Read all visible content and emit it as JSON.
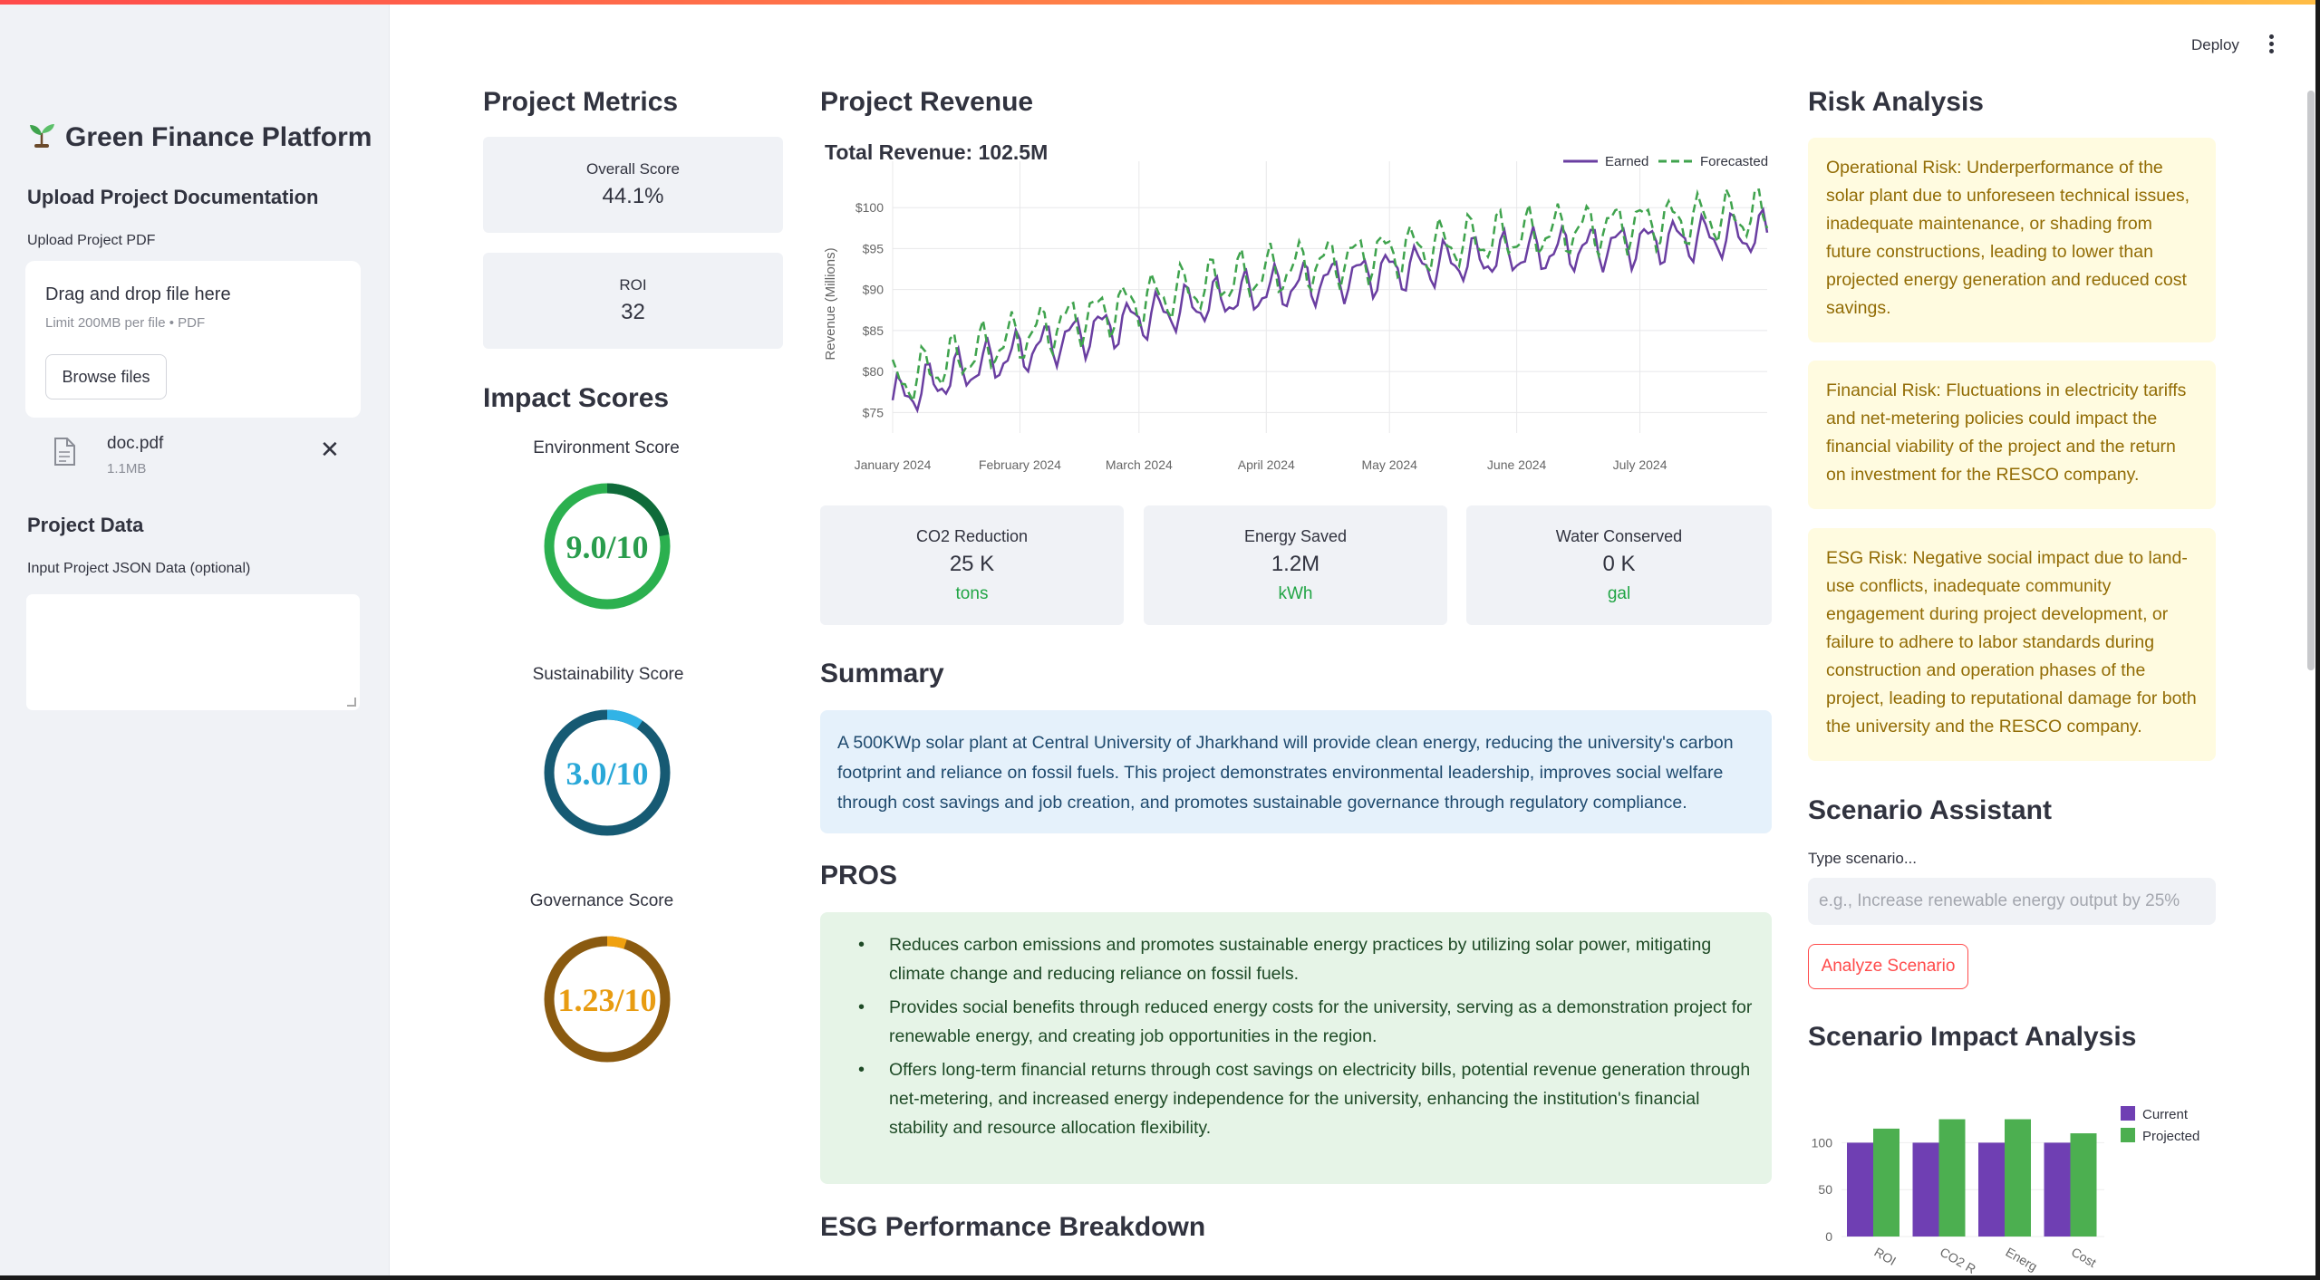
{
  "sidebar": {
    "title": "Green Finance Platform",
    "upload_heading": "Upload Project Documentation",
    "upload_label": "Upload Project PDF",
    "dropzone_text": "Drag and drop file here",
    "dropzone_limit": "Limit 200MB per file • PDF",
    "browse_label": "Browse files",
    "file": {
      "name": "doc.pdf",
      "size": "1.1MB"
    },
    "project_data_heading": "Project Data",
    "json_label": "Input Project JSON Data (optional)",
    "json_value": ""
  },
  "header": {
    "deploy_label": "Deploy"
  },
  "metrics": {
    "heading": "Project Metrics",
    "overall_label": "Overall Score",
    "overall_value": "44.1%",
    "roi_label": "ROI",
    "roi_value": "32"
  },
  "impact": {
    "heading": "Impact Scores",
    "gauges": [
      {
        "title": "Environment Score",
        "text": "9.0/10",
        "value": 9.0,
        "max": 10,
        "bar_color": "#0f6b3a",
        "track_color": "#2bb04f",
        "text_color": "#2a9d4d"
      },
      {
        "title": "Sustainability Score",
        "text": "3.0/10",
        "value": 3.0,
        "max": 10,
        "bar_color": "#31b3e6",
        "track_color": "#165a73",
        "text_color": "#2aa8d8"
      },
      {
        "title": "Governance Score",
        "text": "1.23/10",
        "value": 1.23,
        "max": 10,
        "bar_color": "#f0a10f",
        "track_color": "#8a5a10",
        "text_color": "#e89c12"
      }
    ]
  },
  "revenue": {
    "heading": "Project Revenue"
  },
  "chart_data": {
    "type": "line",
    "title": "Total Revenue: 102.5M",
    "ylabel": "Revenue (Millions)",
    "ylim": [
      72.5,
      104
    ],
    "yticks": [
      "$75",
      "$80",
      "$85",
      "$90",
      "$95",
      "$100"
    ],
    "ytick_values": [
      75,
      80,
      85,
      90,
      95,
      100
    ],
    "xticks": [
      "January 2024",
      "February 2024",
      "March 2024",
      "April 2024",
      "May 2024",
      "June 2024",
      "July 2024"
    ],
    "xtick_days": [
      0,
      31,
      60,
      91,
      121,
      152,
      182
    ],
    "x_start": "2024-01-01",
    "days": 214,
    "legend_position": "top-right",
    "series": [
      {
        "name": "Earned",
        "color": "#6a3ea1",
        "dash": false,
        "start": 76.5,
        "end": 96.8,
        "amplitude": 2.2,
        "period": 7
      },
      {
        "name": "Forecasted",
        "color": "#3fa34d",
        "dash": true,
        "start": 78.2,
        "end": 99.2,
        "amplitude": 2.5,
        "period": 7
      }
    ]
  },
  "esg_metrics": [
    {
      "label": "CO2 Reduction",
      "value": "25 K",
      "unit": "tons"
    },
    {
      "label": "Energy Saved",
      "value": "1.2M",
      "unit": "kWh"
    },
    {
      "label": "Water Conserved",
      "value": "0 K",
      "unit": "gal"
    }
  ],
  "summary": {
    "heading": "Summary",
    "text": "A 500KWp solar plant at Central University of Jharkhand will provide clean energy, reducing the university's carbon footprint and reliance on fossil fuels. This project demonstrates environmental leadership, improves social welfare through cost savings and job creation, and promotes sustainable governance through regulatory compliance."
  },
  "pros": {
    "heading": "PROS",
    "items": [
      "Reduces carbon emissions and promotes sustainable energy practices by utilizing solar power, mitigating climate change and reducing reliance on fossil fuels.",
      "Provides social benefits through reduced energy costs for the university, serving as a demonstration project for renewable energy, and creating job opportunities in the region.",
      "Offers long-term financial returns through cost savings on electricity bills, potential revenue generation through net-metering, and increased energy independence for the university, enhancing the institution's financial stability and resource allocation flexibility."
    ]
  },
  "esg_breakdown": {
    "heading": "ESG Performance Breakdown"
  },
  "risk": {
    "heading": "Risk Analysis",
    "items": [
      "Operational Risk: Underperformance of the solar plant due to unforeseen technical issues, inadequate maintenance, or shading from future constructions, leading to lower than projected energy generation and reduced cost savings.",
      "Financial Risk: Fluctuations in electricity tariffs and net-metering policies could impact the financial viability of the project and the return on investment for the RESCO company.",
      "ESG Risk: Negative social impact due to land-use conflicts, inadequate community engagement during project development, or failure to adhere to labor standards during construction and operation phases of the project, leading to reputational damage for both the university and the RESCO company."
    ]
  },
  "scenario": {
    "heading": "Scenario Assistant",
    "label": "Type scenario...",
    "placeholder": "e.g., Increase renewable energy output by 25%",
    "button": "Analyze Scenario"
  },
  "impact_analysis": {
    "heading": "Scenario Impact Analysis",
    "chart": {
      "type": "bar",
      "categories": [
        "ROI",
        "CO2 R",
        "Energ",
        "Cost"
      ],
      "series": [
        {
          "name": "Current",
          "color": "#6f3fb3",
          "values": [
            100,
            100,
            100,
            100
          ]
        },
        {
          "name": "Projected",
          "color": "#4caf50",
          "values": [
            115,
            125,
            125,
            110
          ]
        }
      ],
      "yticks": [
        "0",
        "50",
        "100"
      ],
      "ylim": [
        0,
        140
      ]
    }
  }
}
